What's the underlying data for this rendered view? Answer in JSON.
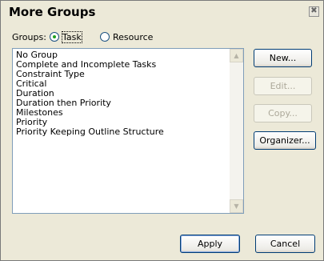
{
  "dialog": {
    "title": "More Groups",
    "close_glyph": "✖"
  },
  "groups": {
    "label": "Groups:",
    "options": [
      {
        "label": "Task",
        "selected": true
      },
      {
        "label": "Resource",
        "selected": false
      }
    ]
  },
  "list": {
    "items": [
      "No Group",
      "Complete and Incomplete Tasks",
      "Constraint Type",
      "Critical",
      "Duration",
      "Duration then Priority",
      "Milestones",
      "Priority",
      "Priority Keeping Outline Structure"
    ],
    "scroll_up_icon": "chevron-up-icon",
    "scroll_down_icon": "chevron-down-icon"
  },
  "buttons": {
    "new": "New...",
    "edit": "Edit...",
    "copy": "Copy...",
    "organizer": "Organizer...",
    "apply": "Apply",
    "cancel": "Cancel"
  },
  "colors": {
    "dialog_bg": "#ece9d8",
    "radio_dot": "#21a121",
    "list_border": "#7f9db9",
    "button_border": "#003c74"
  }
}
